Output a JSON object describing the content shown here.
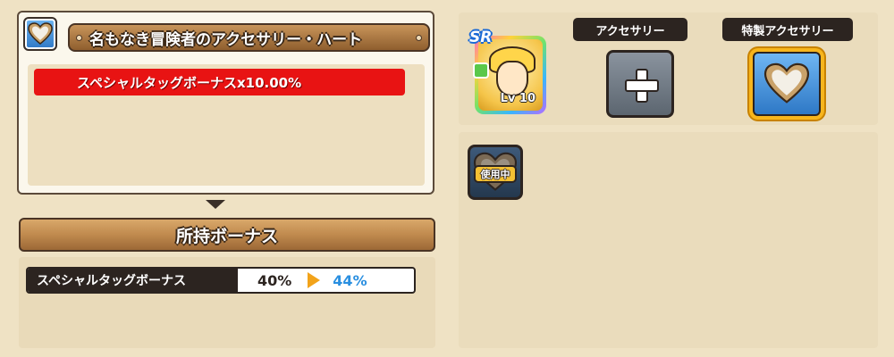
{
  "detail": {
    "accessory_icon": "heart-accessory-icon",
    "title": "名もなき冒険者のアクセサリー・ハート",
    "bonus_text": "スペシャルタッグボーナスx10.00%"
  },
  "owned_bonus": {
    "header": "所持ボーナス",
    "row": {
      "label": "スペシャルタッグボーナス",
      "old_value": "40%",
      "new_value": "44%"
    }
  },
  "character": {
    "rarity": "SR",
    "level": "Lv 10",
    "icon": "character-portrait-icon"
  },
  "slots": {
    "accessory_label": "アクセサリー",
    "special_label": "特製アクセサリー"
  },
  "inventory": {
    "items": [
      {
        "icon": "heart-accessory-icon",
        "badge": "使用中"
      }
    ]
  },
  "colors": {
    "red_bar": "#e81313",
    "new_value_blue": "#2a8fe0",
    "gold_highlight": "#f7b51c",
    "banner_brown": "#c08a4e"
  }
}
